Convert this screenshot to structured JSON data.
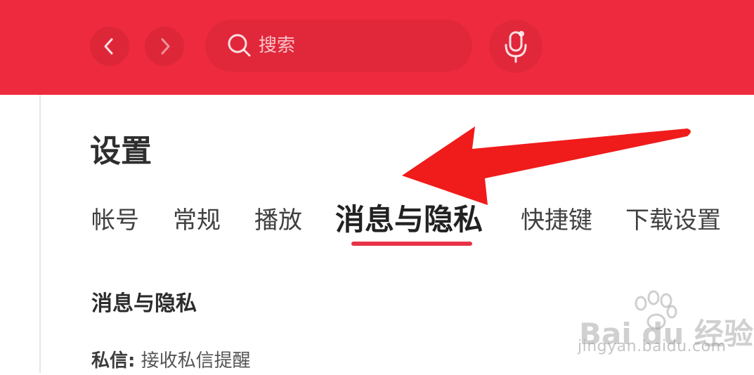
{
  "header": {
    "search_placeholder": "搜索",
    "accent_color": "#ee2a3e"
  },
  "icons": [
    "back-icon",
    "forward-icon",
    "search-icon",
    "microphone-icon",
    "annotation-arrow",
    "baidu-paw-icon"
  ],
  "page": {
    "title": "设置"
  },
  "tabs": [
    {
      "label": "帐号",
      "active": false
    },
    {
      "label": "常规",
      "active": false
    },
    {
      "label": "播放",
      "active": false
    },
    {
      "label": "消息与隐私",
      "active": true
    },
    {
      "label": "快捷键",
      "active": false
    },
    {
      "label": "下载设置",
      "active": false
    }
  ],
  "section": {
    "title": "消息与隐私",
    "row_label": "私信:",
    "row_value": "接收私信提醒"
  },
  "watermark": {
    "brand": "Bai du 经验",
    "url": "jingyan.baidu.com"
  },
  "colors": {
    "tab_underline": "#e83346",
    "arrow": "#f01b1b"
  }
}
